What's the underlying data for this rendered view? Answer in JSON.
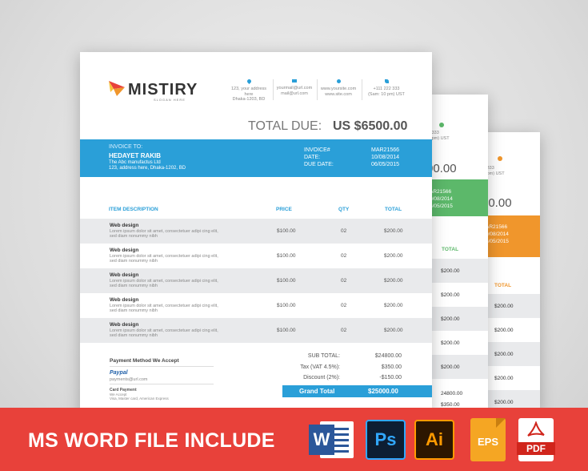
{
  "brand": {
    "name": "MISTIRY",
    "slogan": "SLOGAN HERE"
  },
  "contacts": [
    {
      "icon": "location-icon",
      "line1": "123, your address here",
      "line2": "Dhaka-1203, BD"
    },
    {
      "icon": "mail-icon",
      "line1": "yourmail@url.com",
      "line2": "mail@url.com"
    },
    {
      "icon": "globe-icon",
      "line1": "www.yoursite.com",
      "line2": "www.site.com"
    },
    {
      "icon": "phone-icon",
      "line1": "+111 222 333",
      "line2": "(Sam: 10 pm) UST"
    }
  ],
  "total_due": {
    "label": "TOTAL DUE:",
    "amount": "US $6500.00"
  },
  "invoice_to": {
    "label": "INVOICE TO:",
    "name": "HEDAYET RAKIB",
    "company": "The Abc manufactus Ltd",
    "address": "123, address here, Dhaka-1202, BD"
  },
  "invoice_meta": {
    "number_label": "INVOICE#",
    "number": "MAR21566",
    "date_label": "DATE:",
    "date": "10/08/2014",
    "due_label": "DUE DATE:",
    "due": "06/05/2015"
  },
  "table": {
    "headers": {
      "desc": "ITEM DESCRIPTION",
      "price": "PRICE",
      "qty": "QTY",
      "total": "TOTAL"
    },
    "rows": [
      {
        "title": "Web design",
        "desc1": "Lorem ipsum dolor sit amet, consectetuer adipi cing elit,",
        "desc2": "sed diam nonummy nibh",
        "price": "$100.00",
        "qty": "02",
        "total": "$200.00"
      },
      {
        "title": "Web design",
        "desc1": "Lorem ipsum dolor sit amet, consectetuer adipi cing elit,",
        "desc2": "sed diam nonummy nibh",
        "price": "$100.00",
        "qty": "02",
        "total": "$200.00"
      },
      {
        "title": "Web design",
        "desc1": "Lorem ipsum dolor sit amet, consectetuer adipi cing elit,",
        "desc2": "sed diam nonummy nibh",
        "price": "$100.00",
        "qty": "02",
        "total": "$200.00"
      },
      {
        "title": "Web design",
        "desc1": "Lorem ipsum dolor sit amet, consectetuer adipi cing elit,",
        "desc2": "sed diam nonummy nibh",
        "price": "$100.00",
        "qty": "02",
        "total": "$200.00"
      },
      {
        "title": "Web design",
        "desc1": "Lorem ipsum dolor sit amet, consectetuer adipi cing elit,",
        "desc2": "sed diam nonummy nibh",
        "price": "$100.00",
        "qty": "02",
        "total": "$200.00"
      }
    ]
  },
  "payment": {
    "title": "Payment Method We Accept",
    "paypal": "Paypal",
    "paypal_email": "payments@url.com",
    "card_title": "Card Payment",
    "card_line1": "We Accept",
    "card_line2": "Visa, Master card, American Express"
  },
  "summary": {
    "sub_label": "SUB TOTAL:",
    "sub": "$24800.00",
    "tax_label": "Tax (VAT 4.5%):",
    "tax": "$350.00",
    "discount_label": "Discount (2%):",
    "discount": "-$150.00",
    "grand_label": "Grand Total",
    "grand": "$25000.00"
  },
  "back_page_2": {
    "total": "00.00",
    "contact_line1": "2 333",
    "contact_line2": "0 pm) UST",
    "meta": [
      "AR21566",
      "0/08/2014",
      "6/05/2015"
    ],
    "total_header": "TOTAL",
    "values": [
      "$200.00",
      "$200.00",
      "$200.00",
      "$200.00",
      "$200.00",
      "24800.00",
      "$350.00"
    ]
  },
  "back_page_3": {
    "total": "00.00",
    "contact_line1": "2 333",
    "contact_line2": "0 pm) UST",
    "meta": [
      "AR21566",
      "0/08/2014",
      "6/05/2015"
    ],
    "total_header": "TOTAL",
    "values": [
      "$200.00",
      "$200.00",
      "$200.00",
      "$200.00",
      "$200.00"
    ]
  },
  "banner": {
    "text": "MS WORD FILE INCLUDE"
  },
  "file_icons": {
    "word": "W",
    "ps": "Ps",
    "ai": "Ai",
    "eps": "EPS",
    "pdf": "PDF"
  },
  "colors": {
    "blue": "#2a9fd8",
    "green": "#5cb86a",
    "orange": "#f0962c",
    "banner": "#e8413a"
  }
}
